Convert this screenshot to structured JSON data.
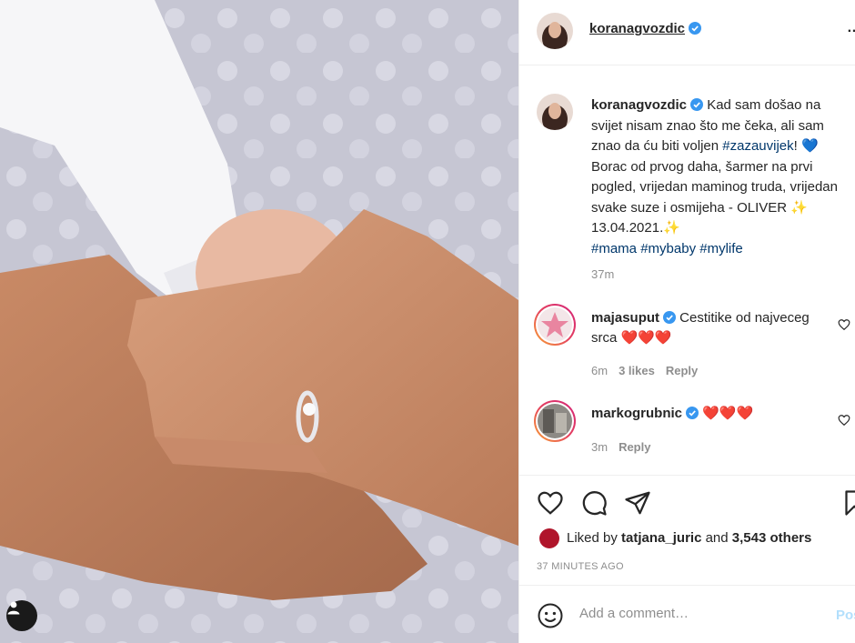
{
  "post": {
    "author": "koranagvozdic",
    "more_label": "…"
  },
  "caption": {
    "username": "koranagvozdic",
    "text_1": " Kad sam došao na svijet nisam znao što me čeka, ali sam znao da ću biti voljen ",
    "hashtag_1": "#zazauvijek",
    "text_2": "! 💙 Borac od prvog daha, šarmer na prvi pogled, vrijedan maminog truda, vrijedan svake suze i osmijeha - OLIVER ✨ 13.04.2021.✨",
    "hashtags": [
      "#mama",
      "#mybaby",
      "#mylife"
    ],
    "time": "37m"
  },
  "comments": [
    {
      "username": "majasuput",
      "text": " Cestitike od najveceg srca ❤️❤️❤️",
      "time": "6m",
      "likes": "3 likes",
      "reply": "Reply"
    },
    {
      "username": "markogrubnic",
      "text": " ❤️❤️❤️",
      "time": "3m",
      "reply": "Reply"
    }
  ],
  "likes": {
    "prefix": "Liked by ",
    "user": "tatjana_juric",
    "middle": " and ",
    "count": "3,543 others"
  },
  "post_age": "37 MINUTES AGO",
  "add_comment": {
    "placeholder": "Add a comment…",
    "post_label": "Post"
  },
  "colors": {
    "verified": "#3897f0",
    "hashtag": "#00376b",
    "meta": "#8e8e8e",
    "post_button": "#b2dffc"
  },
  "icons": [
    "user-tag-icon",
    "verified-icon",
    "heart-icon",
    "comment-icon",
    "share-icon",
    "bookmark-icon",
    "emoji-icon",
    "more-icon"
  ]
}
